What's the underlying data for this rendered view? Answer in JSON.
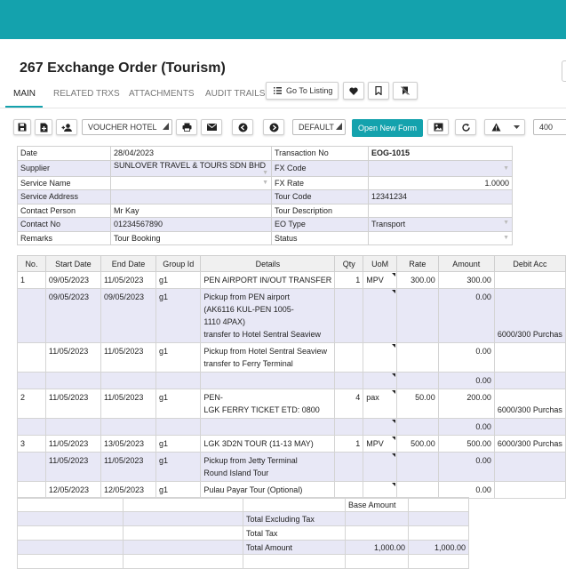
{
  "window": {
    "title": "267 Exchange Order (Tourism)"
  },
  "tabs": [
    {
      "label": "MAIN"
    },
    {
      "label": "RELATED TRXS"
    },
    {
      "label": "ATTACHMENTS"
    },
    {
      "label": "AUDIT TRAILS"
    }
  ],
  "tab_actions": {
    "go_to_listing": "Go To Listing"
  },
  "toolbar": {
    "voucher_select": "VOUCHER HOTEL",
    "default_select": "DEFAULT",
    "open_new_form": "Open New Form",
    "zoom_value": "400"
  },
  "header": {
    "left": [
      {
        "label": "Date",
        "value": "28/04/2023"
      },
      {
        "label": "Supplier",
        "value": "SUNLOVER TRAVEL & TOURS SDN BHD"
      },
      {
        "label": "Service Name",
        "value": ""
      },
      {
        "label": "Service Address",
        "value": ""
      },
      {
        "label": "Contact Person",
        "value": "Mr Kay"
      },
      {
        "label": "Contact No",
        "value": "01234567890"
      },
      {
        "label": "Remarks",
        "value": "Tour Booking"
      }
    ],
    "right": [
      {
        "label": "Transaction No",
        "value": "EOG-1015"
      },
      {
        "label": "FX Code",
        "value": ""
      },
      {
        "label": "FX Rate",
        "value": "1.0000"
      },
      {
        "label": "Tour Code",
        "value": "12341234"
      },
      {
        "label": "Tour Description",
        "value": ""
      },
      {
        "label": "EO Type",
        "value": "Transport"
      },
      {
        "label": "Status",
        "value": ""
      }
    ]
  },
  "lines": {
    "columns": [
      "No.",
      "Start Date",
      "End Date",
      "Group Id",
      "Details",
      "Qty",
      "UoM",
      "Rate",
      "Amount",
      "Debit Acc"
    ],
    "rows": [
      {
        "no": "1",
        "start": "09/05/2023",
        "end": "11/05/2023",
        "group": "g1",
        "details": [
          "PEN AIRPORT IN/OUT TRANSFER"
        ],
        "qty": "1",
        "uom": "MPV",
        "rate": "300.00",
        "amount": "300.00",
        "debit": "",
        "sub": false
      },
      {
        "no": "",
        "start": "09/05/2023",
        "end": "09/05/2023",
        "group": "g1",
        "details": [
          "Pickup from PEN airport",
          "(AK6116 KUL-PEN 1005-",
          "1110 4PAX)",
          "transfer to Hotel Sentral Seaview"
        ],
        "qty": "",
        "uom": "",
        "rate": "",
        "amount": "0.00",
        "debit": "6000/300 Purchas",
        "sub": true
      },
      {
        "no": "",
        "start": "11/05/2023",
        "end": "11/05/2023",
        "group": "g1",
        "details": [
          "Pickup from Hotel Sentral Seaview",
          "transfer to Ferry Terminal"
        ],
        "qty": "",
        "uom": "",
        "rate": "",
        "amount": "0.00",
        "debit": "",
        "sub": false
      },
      {
        "no": "",
        "start": "",
        "end": "",
        "group": "",
        "details": [
          ""
        ],
        "qty": "",
        "uom": "",
        "rate": "",
        "amount": "0.00",
        "debit": "",
        "sub": true
      },
      {
        "no": "2",
        "start": "11/05/2023",
        "end": "11/05/2023",
        "group": "g1",
        "details": [
          "PEN-",
          "LGK FERRY TICKET ETD:  0800"
        ],
        "qty": "4",
        "uom": "pax",
        "rate": "50.00",
        "amount": "200.00",
        "debit": "6000/300 Purchas",
        "sub": false
      },
      {
        "no": "",
        "start": "",
        "end": "",
        "group": "",
        "details": [
          ""
        ],
        "qty": "",
        "uom": "",
        "rate": "",
        "amount": "0.00",
        "debit": "",
        "sub": true
      },
      {
        "no": "3",
        "start": "11/05/2023",
        "end": "13/05/2023",
        "group": "g1",
        "details": [
          "LGK 3D2N TOUR (11-13 MAY)"
        ],
        "qty": "1",
        "uom": "MPV",
        "rate": "500.00",
        "amount": "500.00",
        "debit": "6000/300 Purchas",
        "sub": false
      },
      {
        "no": "",
        "start": "11/05/2023",
        "end": "11/05/2023",
        "group": "g1",
        "details": [
          "Pickup from Jetty Terminal",
          "Round Island Tour"
        ],
        "qty": "",
        "uom": "",
        "rate": "",
        "amount": "0.00",
        "debit": "",
        "sub": true
      },
      {
        "no": "",
        "start": "12/05/2023",
        "end": "12/05/2023",
        "group": "g1",
        "details": [
          "Pulau Payar Tour (Optional)"
        ],
        "qty": "",
        "uom": "",
        "rate": "",
        "amount": "0.00",
        "debit": "",
        "sub": false
      }
    ]
  },
  "totals": {
    "base_amount_header": "Base Amount",
    "rows": [
      {
        "label": "Total Excluding Tax",
        "base": "",
        "value": ""
      },
      {
        "label": "Total Tax",
        "base": "",
        "value": ""
      },
      {
        "label": "Total Amount",
        "base": "1,000.00",
        "value": "1,000.00"
      }
    ]
  },
  "colors": {
    "accent": "#14a2ad",
    "row_alt": "#e8e8f6"
  }
}
